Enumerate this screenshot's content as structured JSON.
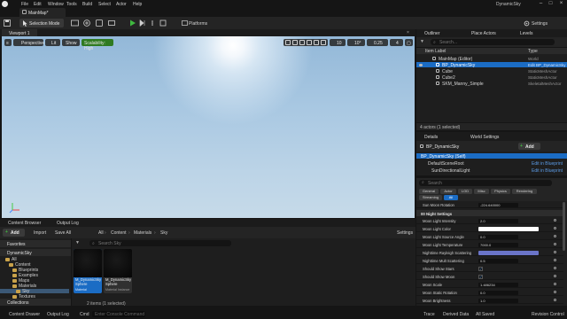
{
  "window": {
    "title": "DynamicSky",
    "menu": [
      "File",
      "Edit",
      "Window",
      "Tools",
      "Build",
      "Select",
      "Actor",
      "Help"
    ],
    "level_tab": "MainMap*"
  },
  "toolbar": {
    "mode": "Selection Mode",
    "platforms": "Platforms",
    "settings": "Settings"
  },
  "viewport": {
    "tab": "Viewport 1",
    "perspective": "Perspective",
    "lit": "Lit",
    "show": "Show",
    "scalability": "Scalability: High",
    "grid_snap": "10",
    "rot_snap": "10°",
    "scale_snap": "0.25",
    "cam_speed": "4"
  },
  "content_browser": {
    "tabs": [
      "Content Browser",
      "Output Log"
    ],
    "add": "Add",
    "import": "Import",
    "save_all": "Save All",
    "breadcrumb": [
      "All",
      "Content",
      "Materials",
      "Sky"
    ],
    "settings": "Settings",
    "search_placeholder": "Search Sky",
    "favorites": "Favorites",
    "project": "DynamicSky",
    "tree": [
      "All",
      "Content",
      "Blueprints",
      "Examples",
      "Maps",
      "Materials",
      "Sky",
      "Textures"
    ],
    "collections": "Collections",
    "assets": [
      {
        "name": "M_DynamicSky Sphere",
        "type": "Material"
      },
      {
        "name": "M_DynamicSky Sphere",
        "type": "Material Instance"
      }
    ],
    "status": "2 items (1 selected)"
  },
  "status_bar": {
    "content_drawer": "Content Drawer",
    "output_log": "Output Log",
    "cmd": "Cmd",
    "cmd_placeholder": "Enter Console Command",
    "trace": "Trace",
    "derived_data": "Derived Data",
    "all_saved": "All Saved",
    "revision_control": "Revision Control"
  },
  "outliner": {
    "tabs": [
      "Outliner",
      "Place Actors",
      "Levels"
    ],
    "search_placeholder": "Search...",
    "col_label": "Item Label",
    "col_type": "Type",
    "rows": [
      {
        "name": "MainMap (Editor)",
        "type": "World"
      },
      {
        "name": "BP_DynamicSky",
        "type": "Edit BP_DynamicSky"
      },
      {
        "name": "Cube",
        "type": "StaticMeshActor"
      },
      {
        "name": "Cube2",
        "type": "StaticMeshActor"
      },
      {
        "name": "SKM_Manny_Simple",
        "type": "SkeletalMeshActor"
      }
    ],
    "status": "4 actors (1 selected)"
  },
  "details": {
    "tabs": [
      "Details",
      "World Settings"
    ],
    "actor": "BP_DynamicSky",
    "add": "Add",
    "components": [
      {
        "name": "BP_DynamicSky (Self)",
        "link": ""
      },
      {
        "name": "DefaultSceneRoot",
        "link": "Edit in Blueprint"
      },
      {
        "name": "SunDirectionalLight",
        "link": "Edit in Blueprint"
      }
    ],
    "search_placeholder": "Search",
    "filters": [
      "General",
      "Actor",
      "LOD",
      "Misc",
      "Physics",
      "Rendering",
      "Streaming",
      "All"
    ],
    "pre_rows": [
      {
        "label": "Sun Moon Rotation",
        "value": "-224.640000"
      }
    ],
    "category": "00 Night Settings",
    "rows": [
      {
        "label": "Moon Light Intensity",
        "kind": "value",
        "value": "2.0"
      },
      {
        "label": "Moon Light Color",
        "kind": "swatch",
        "color": "#ffffff"
      },
      {
        "label": "Moon Light Source Angle",
        "kind": "value",
        "value": "0.0"
      },
      {
        "label": "Moon Light Temperature",
        "kind": "value",
        "value": "7000.0"
      },
      {
        "label": "Nighttime Rayleigh Scattering",
        "kind": "swatch",
        "color": "#6a74c8"
      },
      {
        "label": "Nighttime Mult Scattering",
        "kind": "value",
        "value": "0.5"
      },
      {
        "label": "Should Show Stars",
        "kind": "check",
        "value": "✓"
      },
      {
        "label": "Should Show Moon",
        "kind": "check",
        "value": "✓"
      },
      {
        "label": "Moon Scale",
        "kind": "value",
        "value": "1.486234"
      },
      {
        "label": "Moon Static Rotation",
        "kind": "value",
        "value": "0.0"
      },
      {
        "label": "Moon Brightness",
        "kind": "value",
        "value": "1.0"
      }
    ]
  }
}
